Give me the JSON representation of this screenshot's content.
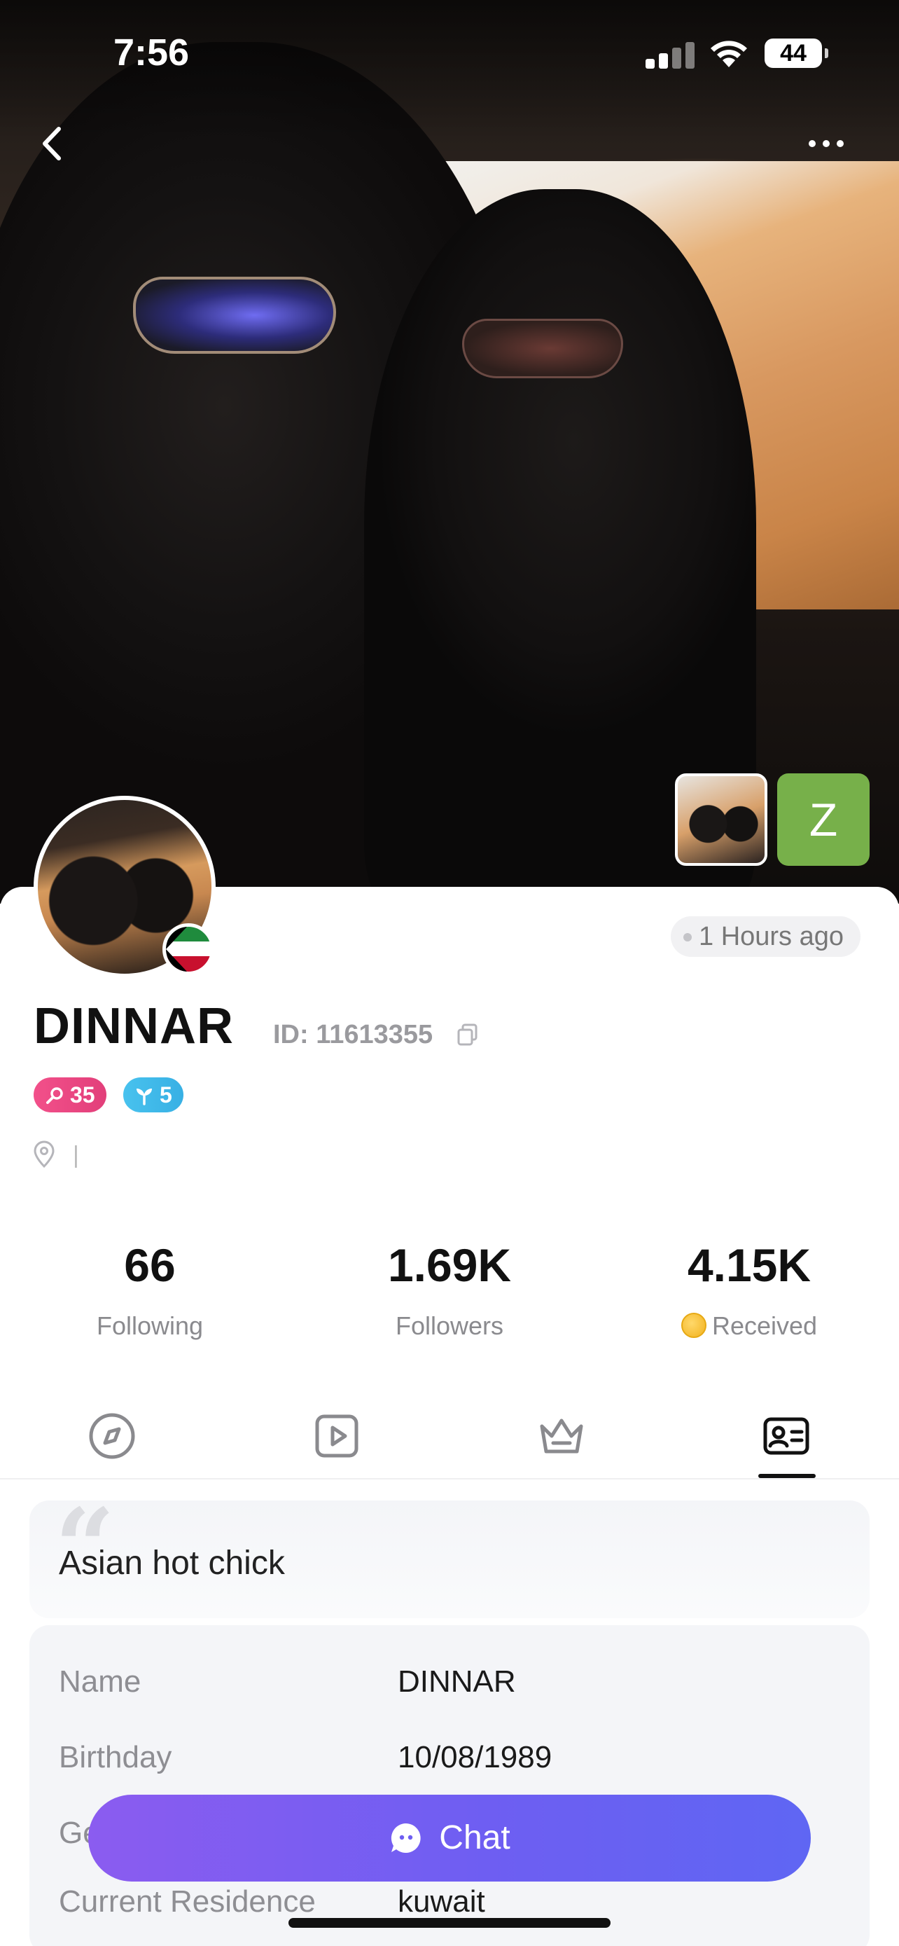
{
  "status_bar": {
    "time": "7:56",
    "battery": "44"
  },
  "profile": {
    "name": "DINNAR",
    "id_label": "ID: 11613355",
    "last_active": "1 Hours ago",
    "level_badge": "35",
    "growth_badge": "5",
    "location": "|",
    "thumbnail_letter": "Z"
  },
  "stats": {
    "following": {
      "value": "66",
      "label": "Following"
    },
    "followers": {
      "value": "1.69K",
      "label": "Followers"
    },
    "received": {
      "value": "4.15K",
      "label": "Received"
    }
  },
  "tabs": [
    {
      "icon": "compass-icon"
    },
    {
      "icon": "play-icon"
    },
    {
      "icon": "crown-icon"
    },
    {
      "icon": "profile-card-icon",
      "active": true
    }
  ],
  "bio": {
    "text": "Asian hot chick"
  },
  "info": [
    {
      "key": "Name",
      "value": "DINNAR"
    },
    {
      "key": "Birthday",
      "value": "10/08/1989"
    },
    {
      "key": "Ge",
      "value": ""
    },
    {
      "key": "Current Residence",
      "value": "kuwait"
    }
  ],
  "actions": {
    "chat_label": "Chat"
  },
  "colors": {
    "accent": "#6e5ef2",
    "level_badge": "#f2508a",
    "growth_badge": "#48c2ee",
    "thumbnail_bg": "#77b04a"
  }
}
